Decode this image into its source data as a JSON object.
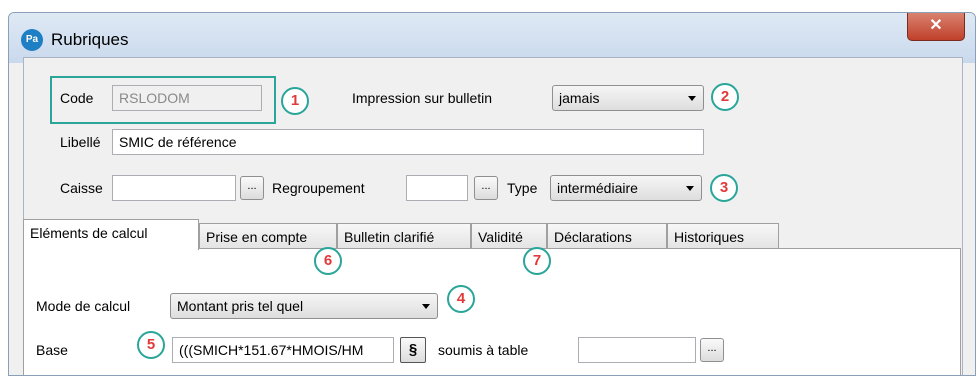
{
  "window": {
    "app_icon_text": "Pa",
    "title": "Rubriques",
    "close_icon": "close-icon"
  },
  "form": {
    "code_label": "Code",
    "code_value": "RSLODOM",
    "impression_label": "Impression sur bulletin",
    "impression_value": "jamais",
    "libelle_label": "Libellé",
    "libelle_value": "SMIC de référence",
    "caisse_label": "Caisse",
    "caisse_value": "",
    "caisse_btn": "...",
    "regroupement_label": "Regroupement",
    "regroupement_value": "",
    "regroupement_btn": "...",
    "type_label": "Type",
    "type_value": "intermédiaire"
  },
  "tabs": [
    {
      "label": "Eléments de calcul",
      "active": true
    },
    {
      "label": "Prise en compte",
      "active": false
    },
    {
      "label": "Bulletin clarifié",
      "active": false
    },
    {
      "label": "Validité",
      "active": false
    },
    {
      "label": "Déclarations",
      "active": false
    },
    {
      "label": "Historiques",
      "active": false
    }
  ],
  "calcul": {
    "mode_label": "Mode de calcul",
    "mode_value": "Montant pris tel quel",
    "base_label": "Base",
    "base_value": "(((SMICH*151.67*HMOIS/HM",
    "section_btn": "§",
    "soumis_label": "soumis à table",
    "soumis_value": "",
    "soumis_btn": "..."
  },
  "annotations": {
    "one": "1",
    "two": "2",
    "three": "3",
    "four": "4",
    "five": "5",
    "six": "6",
    "seven": "7",
    "color": "#2aa59a",
    "number_color": "#e23a3a"
  }
}
